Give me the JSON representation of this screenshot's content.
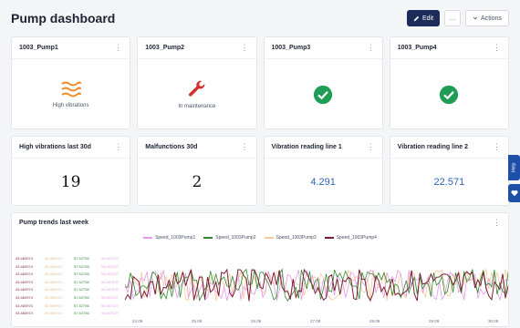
{
  "header": {
    "title": "Pump dashboard",
    "edit_label": "Edit",
    "more_label": "…",
    "actions_label": "Actions"
  },
  "status_cards": [
    {
      "title": "1003_Pump1",
      "status": "High vibrations",
      "icon": "vibration-icon",
      "color": "#f08a24"
    },
    {
      "title": "1003_Pump2",
      "status": "In maintenance",
      "icon": "wrench-icon",
      "color": "#d32f2f"
    },
    {
      "title": "1003_Pump3",
      "status": "",
      "icon": "check-circle-icon",
      "color": "#1f9d55"
    },
    {
      "title": "1003_Pump4",
      "status": "",
      "icon": "check-circle-icon",
      "color": "#1f9d55"
    }
  ],
  "kpi_cards": [
    {
      "title": "High vibrations last 30d",
      "value": "19"
    },
    {
      "title": "Malfunctions 30d",
      "value": "2"
    },
    {
      "title": "Vibration reading line 1",
      "value": "4.291"
    },
    {
      "title": "Vibration reading line 2",
      "value": "22.571"
    }
  ],
  "trend": {
    "title": "Pump trends last week",
    "legend": [
      {
        "name": "Speed_1003Pump1",
        "color": "#e59ae8"
      },
      {
        "name": "Speed_1003Pump2",
        "color": "#2e8b2e"
      },
      {
        "name": "Speed_1003Pump3",
        "color": "#f7c99a"
      },
      {
        "name": "Speed_1003Pump4",
        "color": "#7a1f35"
      }
    ],
    "axis_columns": [
      {
        "color": "#7a1f35",
        "labels": [
          "43.463974",
          "43.463974",
          "43.463974",
          "43.463974",
          "43.463974",
          "43.463974",
          "43.463974",
          "43.463974"
        ]
      },
      {
        "color": "#f7c99a",
        "labels": [
          "43.463974",
          "43.463974",
          "43.463974",
          "43.463974",
          "43.463974",
          "43.463974",
          "43.463974",
          "43.463974"
        ]
      },
      {
        "color": "#2e8b2e",
        "labels": [
          "57.52756",
          "57.52756",
          "57.52756",
          "57.52756",
          "57.52756",
          "57.52756",
          "57.52756",
          "57.52756"
        ]
      },
      {
        "color": "#e59ae8",
        "labels": [
          "53.067427",
          "53.067427",
          "53.067427",
          "53.067427",
          "53.067427",
          "53.067427",
          "53.067427",
          "53.067427"
        ]
      }
    ],
    "x_ticks": [
      "24.09",
      "25.09",
      "26.09",
      "27.09",
      "28.09",
      "29.09",
      "30.09"
    ]
  },
  "side_tabs": {
    "help_label": "Help",
    "fav_icon": "heart-icon"
  }
}
